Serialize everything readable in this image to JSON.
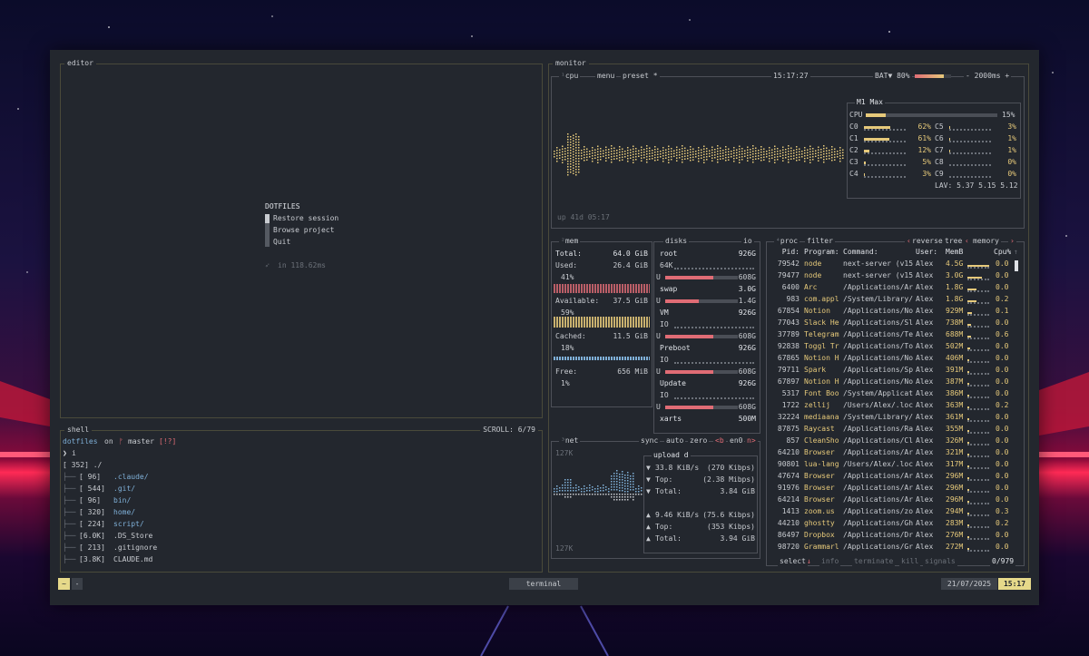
{
  "editor": {
    "title": "editor",
    "heading": "DOTFILES",
    "menu": [
      "Restore session",
      "Browse project",
      "Quit"
    ],
    "timing": "in 118.62ms"
  },
  "shell": {
    "title": "shell",
    "scroll": "SCROLL:  6/79",
    "prompt_dir": "dotfiles",
    "prompt_on": "on",
    "prompt_branch": "master",
    "prompt_status": "[!?]",
    "prompt_symbol": "❯",
    "command": "i",
    "tree_root": "[ 352]  ./",
    "tree": [
      {
        "size": "[  96]",
        "name": ".claude/"
      },
      {
        "size": "[ 544]",
        "name": ".git/"
      },
      {
        "size": "[  96]",
        "name": "bin/"
      },
      {
        "size": "[ 320]",
        "name": "home/"
      },
      {
        "size": "[ 224]",
        "name": "script/"
      },
      {
        "size": "[6.0K]",
        "name": ".DS_Store"
      },
      {
        "size": "[ 213]",
        "name": ".gitignore"
      },
      {
        "size": "[3.8K]",
        "name": "CLAUDE.md"
      }
    ]
  },
  "monitor": {
    "title": "monitor",
    "cpu_tab": "cpu",
    "menu_tab": "menu",
    "preset_tab": "preset *",
    "clock": "15:17:27",
    "battery_label": "BAT▼ 80%",
    "battery_level": 0.8,
    "interval": "- 2000ms +",
    "uptime": "up 41d 05:17",
    "cpu_model": "M1 Max",
    "cpu_total_label": "CPU",
    "cpu_total": "15%",
    "cpu_total_level": 0.15,
    "cores": [
      {
        "name": "C0",
        "pct": "62%",
        "level": 0.62
      },
      {
        "name": "C1",
        "pct": "61%",
        "level": 0.61
      },
      {
        "name": "C2",
        "pct": "12%",
        "level": 0.12
      },
      {
        "name": "C3",
        "pct": "5%",
        "level": 0.05
      },
      {
        "name": "C4",
        "pct": "3%",
        "level": 0.03
      },
      {
        "name": "C5",
        "pct": "3%",
        "level": 0.03
      },
      {
        "name": "C6",
        "pct": "1%",
        "level": 0.01
      },
      {
        "name": "C7",
        "pct": "1%",
        "level": 0.01
      },
      {
        "name": "C8",
        "pct": "0%",
        "level": 0.0
      },
      {
        "name": "C9",
        "pct": "0%",
        "level": 0.0
      }
    ],
    "lav": "LAV: 5.37 5.15 5.12"
  },
  "mem": {
    "title": "mem",
    "total_label": "Total:",
    "total": "64.0 GiB",
    "used_label": "Used:",
    "used": "26.4 GiB",
    "used_pct": "41%",
    "avail_label": "Available:",
    "avail": "37.5 GiB",
    "avail_pct": "59%",
    "cached_label": "Cached:",
    "cached": "11.5 GiB",
    "cached_pct": "18%",
    "free_label": "Free:",
    "free": "656 MiB",
    "free_pct": "1%"
  },
  "disks": {
    "title": "disks",
    "io_tab": "io",
    "items": [
      {
        "name": "root",
        "size": "926G",
        "io": "64K",
        "used": "608G",
        "level": 0.66
      },
      {
        "name": "swap",
        "size": "3.0G",
        "io": "",
        "used": "1.4G",
        "level": 0.46
      },
      {
        "name": "VM",
        "size": "926G",
        "io": "IO",
        "used": "608G",
        "level": 0.66
      },
      {
        "name": "Preboot",
        "size": "926G",
        "io": "IO",
        "used": "608G",
        "level": 0.66
      },
      {
        "name": "Update",
        "size": "926G",
        "io": "IO",
        "used": "608G",
        "level": 0.66
      },
      {
        "name": "xarts",
        "size": "500M",
        "io": "",
        "used": "",
        "level": 0
      }
    ],
    "io_prefix": "U"
  },
  "net": {
    "title": "net",
    "sync": "sync",
    "auto": "auto",
    "zero": "zero",
    "iface_prev": "<b",
    "iface": "en0",
    "iface_next": "n>",
    "scale_top": "127K",
    "scale_bottom": "127K",
    "upload_title": "upload d",
    "down_rate": "33.8 KiB/s",
    "down_bps": "(270 Kibps)",
    "down_top_label": "Top:",
    "down_top": "(2.38 Mibps)",
    "down_total_label": "Total:",
    "down_total": "3.84 GiB",
    "up_rate": "9.46 KiB/s",
    "up_bps": "(75.6 Kibps)",
    "up_top_label": "Top:",
    "up_top": "(353 Kibps)",
    "up_total_label": "Total:",
    "up_total": "3.94 GiB"
  },
  "proc": {
    "title": "proc",
    "filter": "filter",
    "reverse": "reverse",
    "tree": "tree",
    "sort": "memory",
    "columns": [
      "Pid:",
      "Program:",
      "Command:",
      "User:",
      "MemB",
      "Cpu%"
    ],
    "rows": [
      {
        "pid": "79542",
        "prog": "node",
        "cmd": "next-server (v15",
        "user": "Alex",
        "mem": "4.5G",
        "cpu": "0.0"
      },
      {
        "pid": "79477",
        "prog": "node",
        "cmd": "next-server (v15",
        "user": "Alex",
        "mem": "3.0G",
        "cpu": "0.0"
      },
      {
        "pid": "6400",
        "prog": "Arc",
        "cmd": "/Applications/Ar",
        "user": "Alex",
        "mem": "1.8G",
        "cpu": "0.0"
      },
      {
        "pid": "983",
        "prog": "com.appl",
        "cmd": "/System/Library/",
        "user": "Alex",
        "mem": "1.8G",
        "cpu": "0.2"
      },
      {
        "pid": "67854",
        "prog": "Notion",
        "cmd": "/Applications/No",
        "user": "Alex",
        "mem": "929M",
        "cpu": "0.1"
      },
      {
        "pid": "77043",
        "prog": "Slack He",
        "cmd": "/Applications/Sl",
        "user": "Alex",
        "mem": "738M",
        "cpu": "0.0"
      },
      {
        "pid": "37789",
        "prog": "Telegram",
        "cmd": "/Applications/Te",
        "user": "Alex",
        "mem": "688M",
        "cpu": "0.6"
      },
      {
        "pid": "92838",
        "prog": "Toggl Tr",
        "cmd": "/Applications/To",
        "user": "Alex",
        "mem": "502M",
        "cpu": "0.0"
      },
      {
        "pid": "67865",
        "prog": "Notion H",
        "cmd": "/Applications/No",
        "user": "Alex",
        "mem": "406M",
        "cpu": "0.0"
      },
      {
        "pid": "79711",
        "prog": "Spark",
        "cmd": "/Applications/Sp",
        "user": "Alex",
        "mem": "391M",
        "cpu": "0.0"
      },
      {
        "pid": "67897",
        "prog": "Notion H",
        "cmd": "/Applications/No",
        "user": "Alex",
        "mem": "387M",
        "cpu": "0.0"
      },
      {
        "pid": "5317",
        "prog": "Font Boo",
        "cmd": "/System/Applicat",
        "user": "Alex",
        "mem": "386M",
        "cpu": "0.0"
      },
      {
        "pid": "1722",
        "prog": "zellij",
        "cmd": "/Users/Alex/.loc",
        "user": "Alex",
        "mem": "363M",
        "cpu": "0.2"
      },
      {
        "pid": "32224",
        "prog": "mediaana",
        "cmd": "/System/Library/",
        "user": "Alex",
        "mem": "361M",
        "cpu": "0.0"
      },
      {
        "pid": "87875",
        "prog": "Raycast",
        "cmd": "/Applications/Ra",
        "user": "Alex",
        "mem": "355M",
        "cpu": "0.0"
      },
      {
        "pid": "857",
        "prog": "CleanSho",
        "cmd": "/Applications/Cl",
        "user": "Alex",
        "mem": "326M",
        "cpu": "0.0"
      },
      {
        "pid": "64210",
        "prog": "Browser",
        "cmd": "/Applications/Ar",
        "user": "Alex",
        "mem": "321M",
        "cpu": "0.0"
      },
      {
        "pid": "90801",
        "prog": "lua-lang",
        "cmd": "/Users/Alex/.loc",
        "user": "Alex",
        "mem": "317M",
        "cpu": "0.0"
      },
      {
        "pid": "47674",
        "prog": "Browser",
        "cmd": "/Applications/Ar",
        "user": "Alex",
        "mem": "296M",
        "cpu": "0.0"
      },
      {
        "pid": "91976",
        "prog": "Browser",
        "cmd": "/Applications/Ar",
        "user": "Alex",
        "mem": "296M",
        "cpu": "0.0"
      },
      {
        "pid": "64214",
        "prog": "Browser",
        "cmd": "/Applications/Ar",
        "user": "Alex",
        "mem": "296M",
        "cpu": "0.0"
      },
      {
        "pid": "1413",
        "prog": "zoom.us",
        "cmd": "/Applications/zo",
        "user": "Alex",
        "mem": "294M",
        "cpu": "0.3"
      },
      {
        "pid": "44210",
        "prog": "ghostty",
        "cmd": "/Applications/Gh",
        "user": "Alex",
        "mem": "283M",
        "cpu": "0.2"
      },
      {
        "pid": "86497",
        "prog": "Dropbox",
        "cmd": "/Applications/Dr",
        "user": "Alex",
        "mem": "276M",
        "cpu": "0.0"
      },
      {
        "pid": "98720",
        "prog": "Grammarl",
        "cmd": "/Applications/Gr",
        "user": "Alex",
        "mem": "272M",
        "cpu": "0.0"
      }
    ],
    "select": "select",
    "info": "info",
    "terminate": "terminate",
    "kill": "kill",
    "signals": "signals",
    "count": "0/979"
  },
  "statusbar": {
    "mode1": "~",
    "mode2": "-",
    "tab": "terminal",
    "date": "21/07/2025",
    "time": "15:17"
  },
  "colors": {
    "accent": "#e6c97a",
    "red": "#e06c75",
    "bg": "#23272e",
    "statusbar_time_bg": "#e6d98a"
  }
}
